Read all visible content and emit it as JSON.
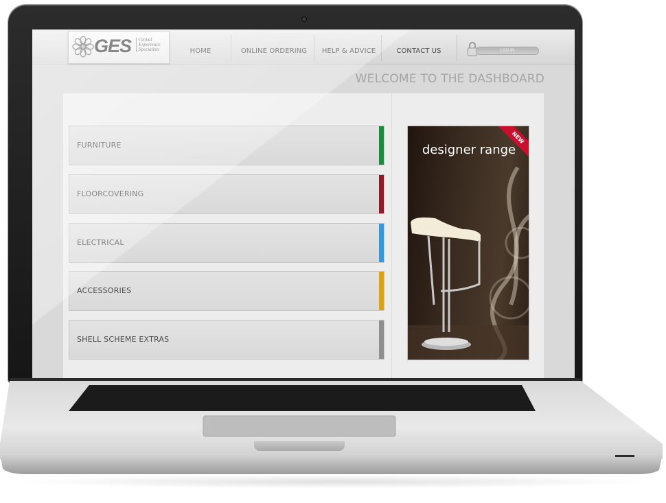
{
  "nav": {
    "logo_text": "GES",
    "logo_subtitle": "Global Experience Specialists",
    "items": [
      {
        "label": "HOME"
      },
      {
        "label": "ONLINE ORDERING"
      },
      {
        "label": "HELP & ADVICE"
      },
      {
        "label": "CONTACT US"
      }
    ],
    "login_label": "LOG IN"
  },
  "page_title": "WELCOME TO THE DASHBOARD",
  "categories": [
    {
      "label": "FURNITURE",
      "color": "#1f8a3f"
    },
    {
      "label": "FLOORCOVERING",
      "color": "#8b1e2b"
    },
    {
      "label": "ELECTRICAL",
      "color": "#3b96d6"
    },
    {
      "label": "ACCESSORIES",
      "color": "#d9a21d"
    },
    {
      "label": "SHELL SCHEME EXTRAS",
      "color": "#8e8e8e"
    }
  ],
  "promo": {
    "title": "designer range",
    "badge": "NEW",
    "badge_color": "#c8102e"
  }
}
